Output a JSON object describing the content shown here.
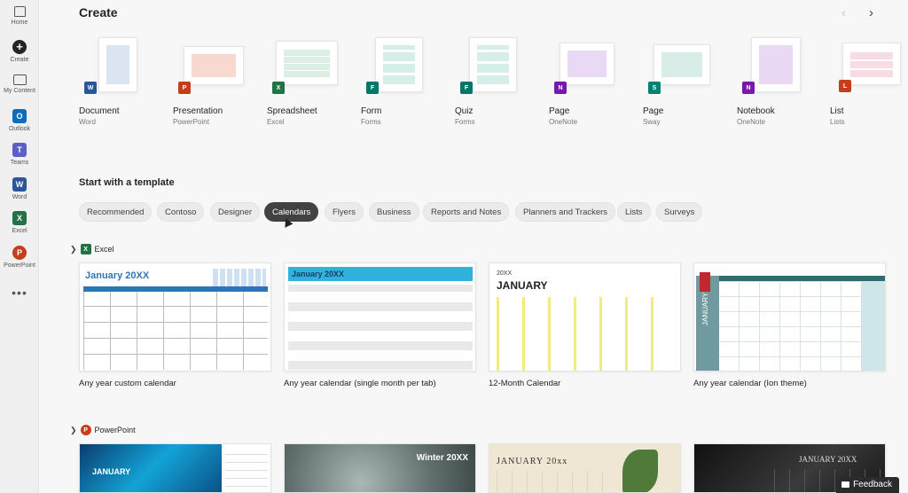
{
  "rail": {
    "items": [
      {
        "label": "Home",
        "icon": "home-icon"
      },
      {
        "label": "Create",
        "icon": "create-icon"
      },
      {
        "label": "My Content",
        "icon": "folder-icon"
      },
      {
        "label": "Outlook",
        "icon": "outlook-icon"
      },
      {
        "label": "Teams",
        "icon": "teams-icon"
      },
      {
        "label": "Word",
        "icon": "word-icon"
      },
      {
        "label": "Excel",
        "icon": "excel-icon"
      },
      {
        "label": "PowerPoint",
        "icon": "powerpoint-icon"
      }
    ],
    "more": "•••"
  },
  "header": {
    "title": "Create",
    "prev": "‹",
    "next": "›"
  },
  "create_items": [
    {
      "name": "Document",
      "app": "Word",
      "color": "#2b579a",
      "badge": "W",
      "tint": "#dbe5f1"
    },
    {
      "name": "Presentation",
      "app": "PowerPoint",
      "color": "#c43e1c",
      "badge": "P",
      "tint": "#f7d9d0"
    },
    {
      "name": "Spreadsheet",
      "app": "Excel",
      "color": "#217346",
      "badge": "X",
      "tint": "#dcefe4"
    },
    {
      "name": "Form",
      "app": "Forms",
      "color": "#077568",
      "badge": "F",
      "tint": "#d6eee9"
    },
    {
      "name": "Quiz",
      "app": "Forms",
      "color": "#077568",
      "badge": "F",
      "tint": "#d6eee9"
    },
    {
      "name": "Page",
      "app": "OneNote",
      "color": "#7719aa",
      "badge": "N",
      "tint": "#ead9f4"
    },
    {
      "name": "Page",
      "app": "Sway",
      "color": "#008272",
      "badge": "S",
      "tint": "#d8ece8"
    },
    {
      "name": "Notebook",
      "app": "OneNote",
      "color": "#7719aa",
      "badge": "N",
      "tint": "#ead9f4"
    },
    {
      "name": "List",
      "app": "Lists",
      "color": "#c43e1c",
      "badge": "L",
      "tint": "#f6dde4"
    }
  ],
  "templates": {
    "title": "Start with a template",
    "chips": [
      "Recommended",
      "Contoso",
      "Designer",
      "Calendars",
      "Flyers",
      "Business",
      "Reports and Notes",
      "Planners and Trackers",
      "Lists",
      "Surveys"
    ],
    "active_chip": "Calendars"
  },
  "groups": {
    "excel": {
      "label": "Excel",
      "cards": [
        {
          "caption": "Any year custom calendar",
          "heading": "January 20XX"
        },
        {
          "caption": "Any year calendar (single month per tab)",
          "heading": "January 20XX"
        },
        {
          "caption": "12-Month Calendar",
          "year": "20XX",
          "heading": "JANUARY"
        },
        {
          "caption": "Any year calendar (Ion theme)",
          "heading": "JANUARY"
        }
      ]
    },
    "powerpoint": {
      "label": "PowerPoint",
      "cards": [
        {
          "heading": "JANUARY"
        },
        {
          "heading": "Winter 20XX"
        },
        {
          "heading": "JANUARY 20xx"
        },
        {
          "heading": "JANUARY 20XX"
        }
      ]
    }
  },
  "feedback": "Feedback"
}
